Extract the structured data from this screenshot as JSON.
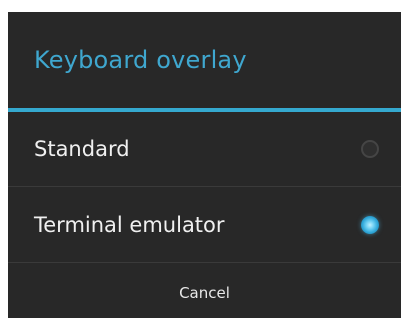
{
  "dialog": {
    "title": "Keyboard overlay",
    "options": [
      {
        "label": "Standard",
        "selected": false
      },
      {
        "label": "Terminal emulator",
        "selected": true
      }
    ],
    "cancel_label": "Cancel",
    "colors": {
      "background": "#282828",
      "accent": "#35a9cf",
      "title_text": "#3fa7cf",
      "text": "#f0f0f0"
    }
  }
}
